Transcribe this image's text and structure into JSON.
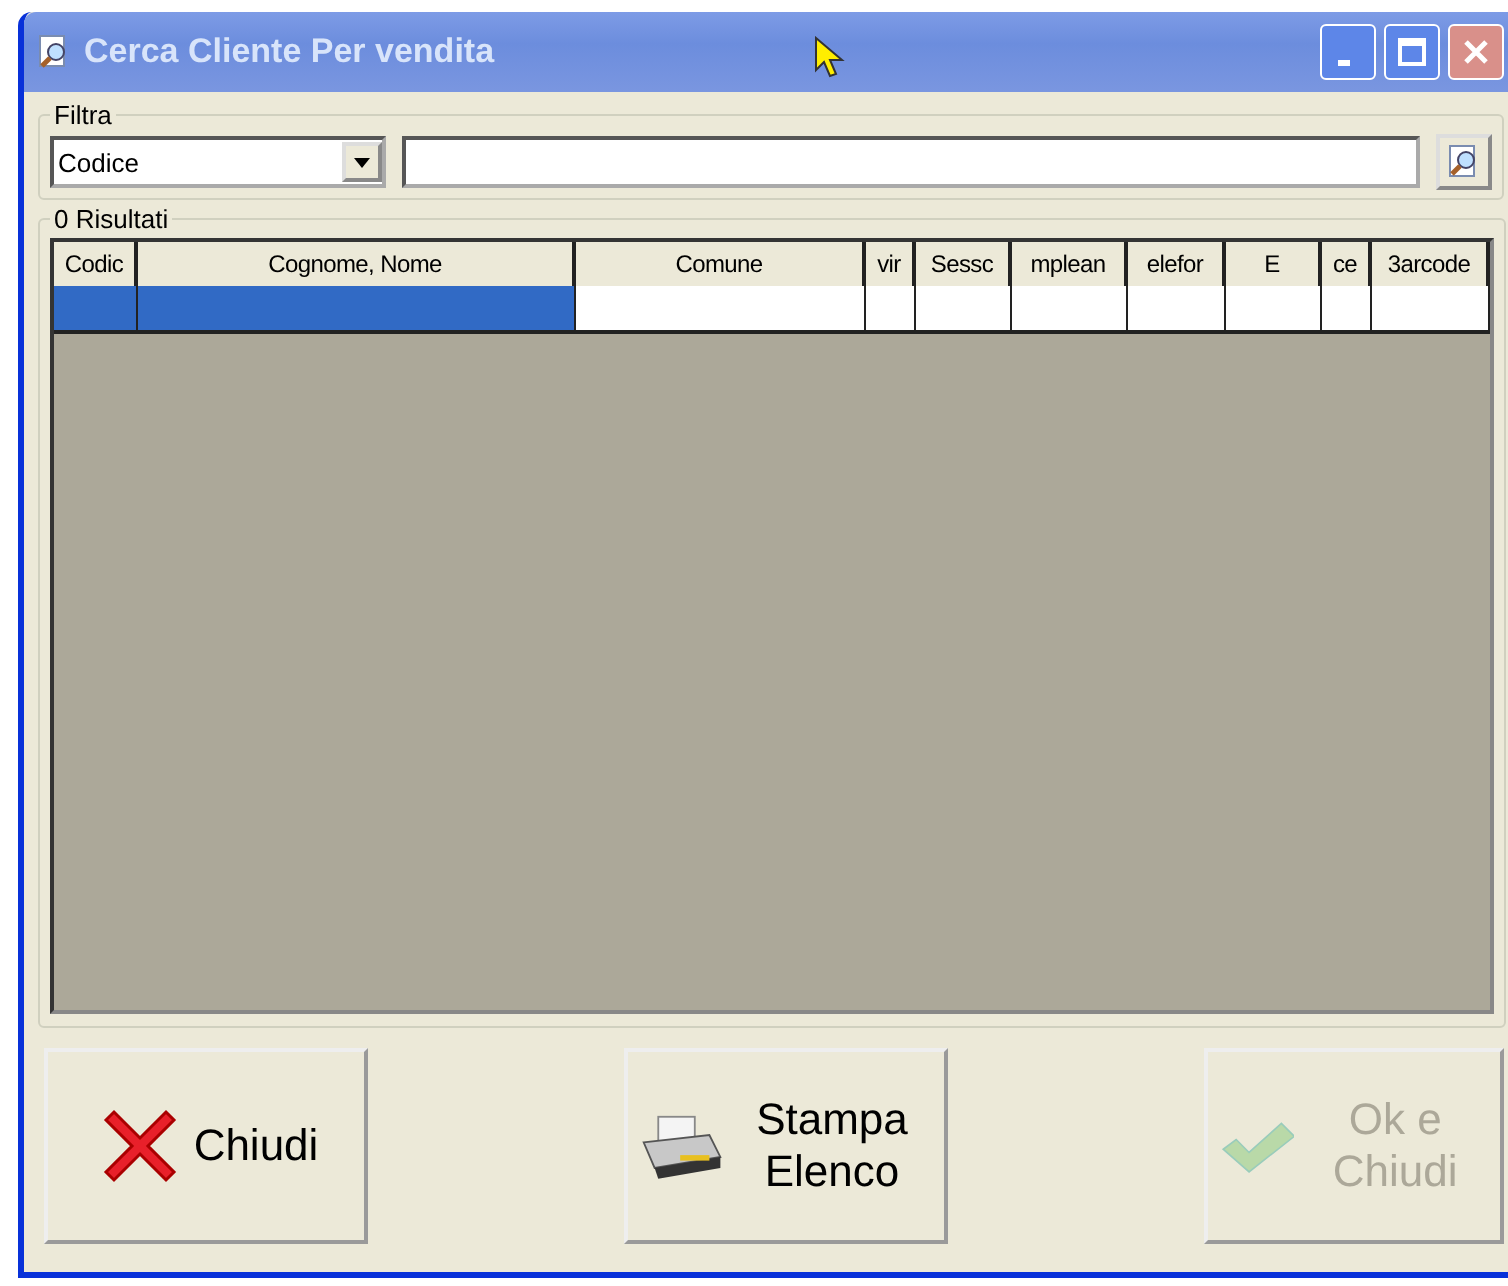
{
  "window": {
    "title": "Cerca Cliente Per vendita"
  },
  "filter": {
    "legend": "Filtra",
    "field": {
      "value": "Codice"
    }
  },
  "results": {
    "legend": "0 Risultati",
    "columns": [
      "Codic",
      "Cognome, Nome",
      "Comune",
      "vir",
      "Sessc",
      "mplean",
      "elefor",
      "E",
      "ce",
      "3arcode"
    ],
    "rows": [
      {
        "cells": [
          {
            "selected": true
          },
          {
            "selected": true
          },
          {
            "selected": false
          },
          {
            "selected": false
          },
          {
            "selected": false
          },
          {
            "selected": false
          },
          {
            "selected": false
          },
          {
            "selected": false
          },
          {
            "selected": false
          },
          {
            "selected": false
          }
        ]
      }
    ]
  },
  "buttons": [
    {
      "kind": "close",
      "label": "Chiudi",
      "disabled": false
    },
    {
      "kind": "print",
      "label": "Stampa Elenco",
      "disabled": false
    },
    {
      "kind": "confirm",
      "label": "Ok e Chiudi",
      "disabled": true
    }
  ]
}
